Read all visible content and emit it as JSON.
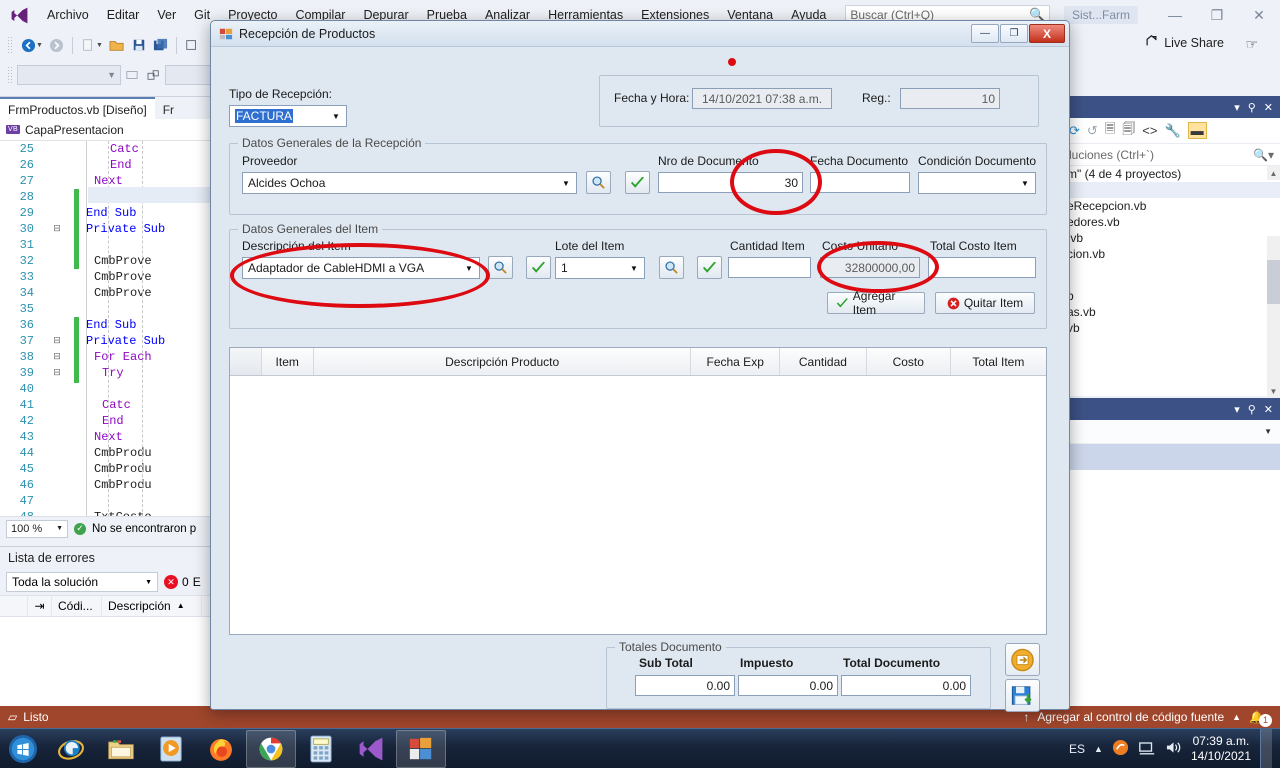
{
  "ide": {
    "menu": [
      "Archivo",
      "Editar",
      "Ver",
      "Git",
      "Proyecto",
      "Compilar",
      "Depurar",
      "Prueba",
      "Analizar",
      "Herramientas",
      "Extensiones",
      "Ventana",
      "Ayuda"
    ],
    "search_placeholder": "Buscar (Ctrl+Q)",
    "project_badge": "Sist...Farm",
    "live_share": "Live Share",
    "editor": {
      "tab_active": "FrmProductos.vb [Diseño]",
      "tab_other": "Fr",
      "breadcrumb_badge": "VB",
      "breadcrumb": "CapaPresentacion",
      "zoom": "100 %",
      "status": "No se encontraron p",
      "lines": [
        {
          "n": "25",
          "text": "Catc",
          "cls": "kw2",
          "indent": 46
        },
        {
          "n": "26",
          "text": "End",
          "cls": "kw2",
          "indent": 46
        },
        {
          "n": "27",
          "text": "Next",
          "cls": "kw2",
          "indent": 30
        },
        {
          "n": "28",
          "text": "",
          "cls": "id",
          "indent": 0
        },
        {
          "n": "29",
          "text": "End Sub",
          "cls": "kw",
          "indent": 22
        },
        {
          "n": "30",
          "text": "Private Sub",
          "cls": "kw",
          "indent": 22
        },
        {
          "n": "31",
          "text": "",
          "cls": "id",
          "indent": 0
        },
        {
          "n": "32",
          "text": "CmbProve",
          "cls": "id",
          "indent": 30
        },
        {
          "n": "33",
          "text": "CmbProve",
          "cls": "id",
          "indent": 30
        },
        {
          "n": "34",
          "text": "CmbProve",
          "cls": "id",
          "indent": 30
        },
        {
          "n": "35",
          "text": "",
          "cls": "id",
          "indent": 0
        },
        {
          "n": "36",
          "text": "End Sub",
          "cls": "kw",
          "indent": 22
        },
        {
          "n": "37",
          "text": "Private Sub",
          "cls": "kw",
          "indent": 22
        },
        {
          "n": "38",
          "text": "For Each",
          "cls": "kw2",
          "indent": 30
        },
        {
          "n": "39",
          "text": "Try",
          "cls": "kw2",
          "indent": 38
        },
        {
          "n": "40",
          "text": "",
          "cls": "id",
          "indent": 0
        },
        {
          "n": "41",
          "text": "Catc",
          "cls": "kw2",
          "indent": 38
        },
        {
          "n": "42",
          "text": "End",
          "cls": "kw2",
          "indent": 38
        },
        {
          "n": "43",
          "text": "Next",
          "cls": "kw2",
          "indent": 30
        },
        {
          "n": "44",
          "text": "CmbProdu",
          "cls": "id",
          "indent": 30
        },
        {
          "n": "45",
          "text": "CmbProdu",
          "cls": "id",
          "indent": 30
        },
        {
          "n": "46",
          "text": "CmbProdu",
          "cls": "id",
          "indent": 30
        },
        {
          "n": "47",
          "text": "",
          "cls": "id",
          "indent": 0
        },
        {
          "n": "48",
          "text": "TxtCosto",
          "cls": "id",
          "indent": 30
        }
      ]
    },
    "error_list": {
      "title": "Lista de errores",
      "scope": "Toda la solución",
      "error_count": "0",
      "columns": [
        "",
        "",
        "Códi...",
        "Descripción"
      ],
      "sort_arrow": "▲"
    },
    "solution_explorer": {
      "search_placeholder": "luciones (Ctrl+`)",
      "root": "m\" (4 de 4 proyectos)",
      "items": [
        "eRecepcion.vb",
        "edores.vb",
        ".vb",
        "cion.vb",
        "",
        "b",
        "as.vb",
        "vb"
      ]
    },
    "status_bar": {
      "ready": "Listo",
      "source_control": "Agregar al control de código fuente",
      "notifications": "1"
    }
  },
  "dialog": {
    "title": "Recepción de Productos",
    "buttons": {
      "minimize": "—",
      "maximize": "❐",
      "close": "X"
    },
    "tipo_recepcion_label": "Tipo de Recepción:",
    "tipo_recepcion_value": "FACTURA",
    "fecha_hora_label": "Fecha y Hora:",
    "fecha_hora_value": "14/10/2021 07:38 a.m.",
    "reg_label": "Reg.:",
    "reg_value": "10",
    "grupo_recepcion": {
      "title": "Datos Generales de la Recepción",
      "proveedor_label": "Proveedor",
      "proveedor_value": "Alcides Ochoa",
      "nro_documento_label": "Nro de Documento",
      "nro_documento_value": "30",
      "fecha_documento_label": "Fecha Documento",
      "fecha_documento_value": "",
      "condicion_documento_label": "Condición Documento",
      "condicion_documento_value": ""
    },
    "grupo_item": {
      "title": "Datos Generales del Item",
      "descripcion_label": "Descripción del Item",
      "descripcion_value": "Adaptador de CableHDMI a VGA",
      "lote_label": "Lote del Item",
      "lote_value": "1",
      "cantidad_label": "Cantidad Item",
      "cantidad_value": "",
      "costo_unitario_label": "Costo Unitario",
      "costo_unitario_value": "32800000,00",
      "total_costo_label": "Total Costo Item",
      "total_costo_value": "",
      "agregar_item": "Agregar Item",
      "quitar_item": "Quitar Item"
    },
    "grid": {
      "columns": [
        "",
        "Item",
        "Descripción Producto",
        "Fecha Exp",
        "Cantidad",
        "Costo",
        "Total Item"
      ],
      "rows": []
    },
    "totales": {
      "title": "Totales Documento",
      "sub_total_label": "Sub Total",
      "sub_total_value": "0.00",
      "impuesto_label": "Impuesto",
      "impuesto_value": "0.00",
      "total_documento_label": "Total Documento",
      "total_documento_value": "0.00"
    },
    "annotation_color": "#dd0a12"
  },
  "taskbar": {
    "language": "ES",
    "time": "07:39 a.m.",
    "date": "14/10/2021",
    "apps": [
      "start-orb",
      "internet-explorer",
      "file-explorer",
      "media-player",
      "firefox",
      "chrome",
      "calculator",
      "visual-studio",
      "winforms-app"
    ]
  }
}
